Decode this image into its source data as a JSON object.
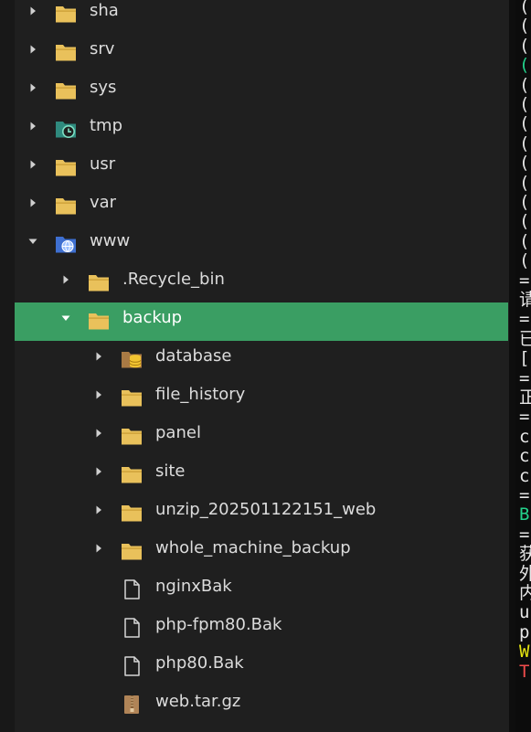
{
  "file_tree": {
    "items": [
      {
        "name": "sha",
        "icon": "folder-icon",
        "expanded": false
      },
      {
        "name": "srv",
        "icon": "folder-icon",
        "expanded": false
      },
      {
        "name": "sys",
        "icon": "folder-icon",
        "expanded": false
      },
      {
        "name": "tmp",
        "icon": "temp-folder-icon",
        "expanded": false
      },
      {
        "name": "usr",
        "icon": "folder-icon",
        "expanded": false
      },
      {
        "name": "var",
        "icon": "folder-icon",
        "expanded": false
      },
      {
        "name": "www",
        "icon": "web-folder-icon",
        "expanded": true
      },
      {
        "name": ".Recycle_bin",
        "icon": "folder-icon",
        "expanded": false
      },
      {
        "name": "backup",
        "icon": "folder-icon",
        "expanded": true,
        "selected": true
      },
      {
        "name": "database",
        "icon": "database-folder-icon",
        "expanded": false
      },
      {
        "name": "file_history",
        "icon": "folder-icon",
        "expanded": false
      },
      {
        "name": "panel",
        "icon": "folder-icon",
        "expanded": false
      },
      {
        "name": "site",
        "icon": "folder-icon",
        "expanded": false
      },
      {
        "name": "unzip_202501122151_web",
        "icon": "folder-icon",
        "expanded": false
      },
      {
        "name": "whole_machine_backup",
        "icon": "folder-icon",
        "expanded": false
      },
      {
        "name": "nginxBak",
        "icon": "file-icon"
      },
      {
        "name": "php-fpm80.Bak",
        "icon": "file-icon"
      },
      {
        "name": "php80.Bak",
        "icon": "file-icon"
      },
      {
        "name": "web.tar.gz",
        "icon": "archive-icon"
      }
    ]
  },
  "terminal": {
    "lines": [
      "(",
      "(",
      "(",
      "(",
      "(",
      "(",
      "(",
      "(",
      "(",
      "(",
      "(",
      "(",
      "(",
      "(",
      "=",
      "请",
      "=",
      "已",
      "[",
      "=",
      "正",
      "=",
      "c",
      "c",
      "c",
      "=",
      "B",
      "=",
      "获",
      "外",
      "内",
      "u",
      "p",
      "W",
      "T"
    ],
    "colors": {
      "default": "#e6e6e6",
      "green": "#23d18b",
      "yellow": "#e5e510",
      "red": "#f14c4c"
    }
  },
  "colors": {
    "selection": "#3a9e63",
    "folder": "#e9c15b",
    "text": "#dcdcdc"
  }
}
